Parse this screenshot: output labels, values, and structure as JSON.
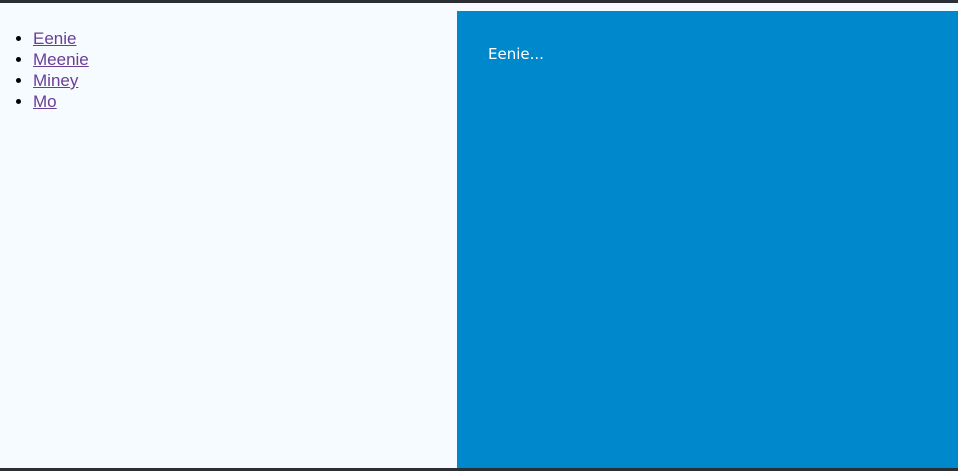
{
  "nav": {
    "items": [
      {
        "label": "Eenie"
      },
      {
        "label": "Meenie"
      },
      {
        "label": "Miney"
      },
      {
        "label": "Mo"
      }
    ]
  },
  "content": {
    "text": "Eenie..."
  },
  "colors": {
    "page_background": "#f6fbff",
    "content_background": "#0088cc",
    "link_color": "#6a3e93",
    "content_text_color": "#ffffff"
  }
}
